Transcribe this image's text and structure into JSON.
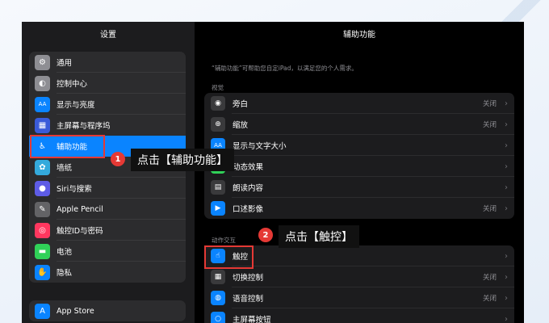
{
  "sidebar": {
    "title": "设置",
    "group1": [
      {
        "label": "通用",
        "icon": "gear-icon",
        "glyph": "⚙",
        "color": "#8e8e93"
      },
      {
        "label": "控制中心",
        "icon": "control-center-icon",
        "glyph": "◐",
        "color": "#8e8e93"
      },
      {
        "label": "显示与亮度",
        "icon": "display-icon",
        "glyph": "AA",
        "color": "#0a84ff"
      },
      {
        "label": "主屏幕与程序坞",
        "icon": "home-screen-icon",
        "glyph": "▦",
        "color": "#3a5bd9"
      },
      {
        "label": "辅助功能",
        "icon": "accessibility-icon",
        "glyph": "♿",
        "color": "#0a84ff",
        "active": true
      },
      {
        "label": "墙纸",
        "icon": "wallpaper-icon",
        "glyph": "✿",
        "color": "#34aadc"
      },
      {
        "label": "Siri与搜索",
        "icon": "siri-icon",
        "glyph": "●",
        "color": "#5e5ce6"
      },
      {
        "label": "Apple Pencil",
        "icon": "pencil-icon",
        "glyph": "✎",
        "color": "#636366"
      },
      {
        "label": "触控ID与密码",
        "icon": "fingerprint-icon",
        "glyph": "◎",
        "color": "#ff375f"
      },
      {
        "label": "电池",
        "icon": "battery-icon",
        "glyph": "▬",
        "color": "#30d158"
      },
      {
        "label": "隐私",
        "icon": "privacy-hand-icon",
        "glyph": "✋",
        "color": "#0a84ff"
      }
    ],
    "group2": [
      {
        "label": "App Store",
        "icon": "app-store-icon",
        "glyph": "A",
        "color": "#0a84ff"
      }
    ]
  },
  "main": {
    "title": "辅助功能",
    "description": "“辅助功能”可帮助您自定iPad，以满足您的个人需求。",
    "vision_label": "视觉",
    "vision": [
      {
        "label": "旁白",
        "value": "关闭",
        "icon": "voiceover-icon",
        "glyph": "◉",
        "color": "#3a3a3c"
      },
      {
        "label": "缩放",
        "value": "关闭",
        "icon": "zoom-icon",
        "glyph": "⊕",
        "color": "#3a3a3c"
      },
      {
        "label": "显示与文字大小",
        "value": "",
        "icon": "text-size-icon",
        "glyph": "AA",
        "color": "#0a84ff"
      },
      {
        "label": "动态效果",
        "value": "",
        "icon": "motion-icon",
        "glyph": "◌",
        "color": "#30d158"
      },
      {
        "label": "朗读内容",
        "value": "",
        "icon": "spoken-content-icon",
        "glyph": "▤",
        "color": "#3a3a3c"
      },
      {
        "label": "口述影像",
        "value": "关闭",
        "icon": "audio-description-icon",
        "glyph": "▶",
        "color": "#0a84ff"
      }
    ],
    "interaction_label": "动作交互",
    "interaction": [
      {
        "label": "触控",
        "value": "",
        "icon": "touch-icon",
        "glyph": "☝",
        "color": "#0a84ff"
      },
      {
        "label": "切换控制",
        "value": "关闭",
        "icon": "switch-control-icon",
        "glyph": "▦",
        "color": "#3a3a3c"
      },
      {
        "label": "语音控制",
        "value": "关闭",
        "icon": "voice-control-icon",
        "glyph": "◍",
        "color": "#0a84ff"
      },
      {
        "label": "主屏幕按钮",
        "value": "",
        "icon": "home-button-icon",
        "glyph": "○",
        "color": "#0a84ff"
      }
    ],
    "chevron": "›"
  },
  "annotations": {
    "step1_number": "1",
    "step1_text": "点击【辅助功能】",
    "step2_number": "2",
    "step2_text": "点击【触控】",
    "highlight_color": "#e53935"
  }
}
